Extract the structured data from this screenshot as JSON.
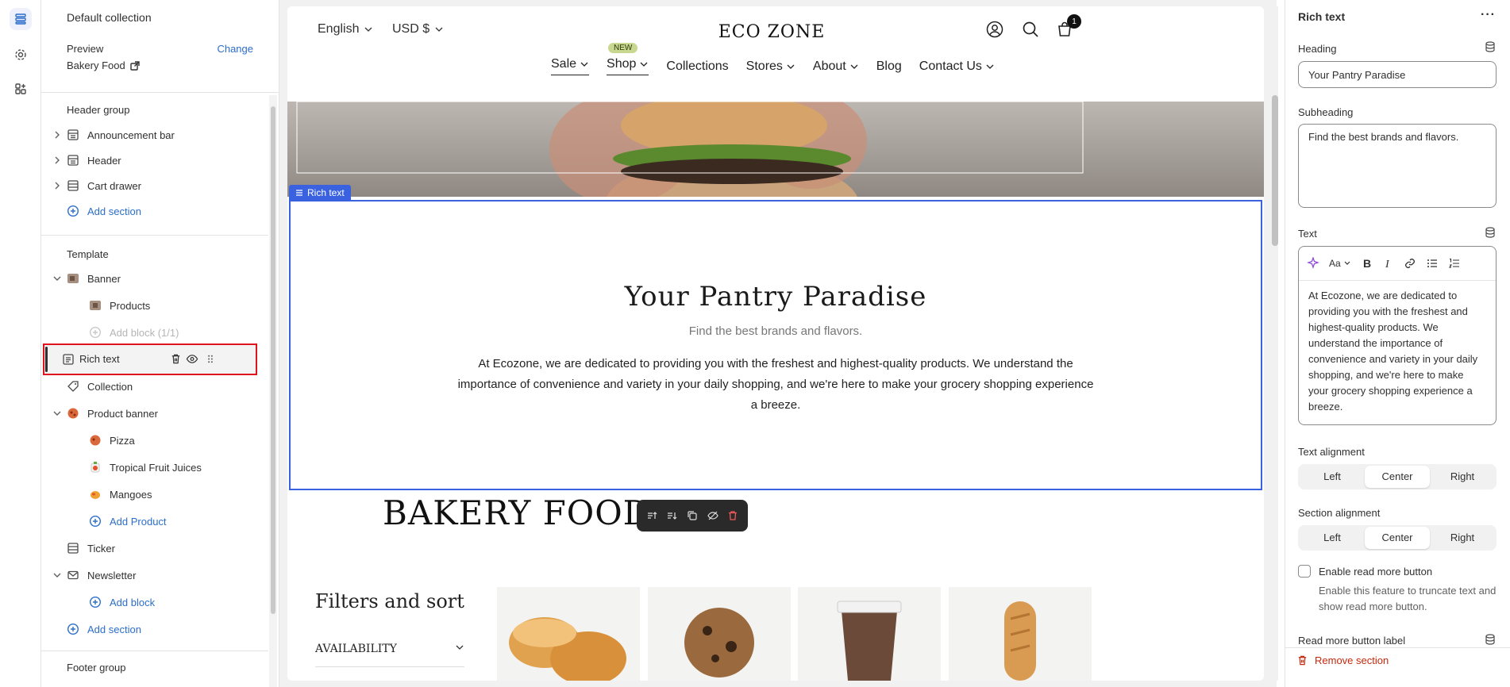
{
  "left_panel": {
    "collection_title": "Default collection",
    "preview_label": "Preview",
    "change_label": "Change",
    "store_name": "Bakery Food",
    "header_group": "Header group",
    "header_items": [
      "Announcement bar",
      "Header",
      "Cart drawer"
    ],
    "add_section": "Add section",
    "template_label": "Template",
    "banner": "Banner",
    "banner_child": "Products",
    "add_block_disabled": "Add block (1/1)",
    "rich_text": "Rich text",
    "collection": "Collection",
    "product_banner": "Product banner",
    "product_banner_children": [
      "Pizza",
      "Tropical Fruit Juices",
      "Mangoes"
    ],
    "add_product": "Add Product",
    "ticker": "Ticker",
    "newsletter": "Newsletter",
    "add_block": "Add block",
    "add_section_2": "Add section",
    "footer_group": "Footer group"
  },
  "store": {
    "language": "English",
    "currency": "USD $",
    "logo": "ECO ZONE",
    "cart_count": "1",
    "nav": [
      "Sale",
      "Shop",
      "Collections",
      "Stores",
      "About",
      "Blog",
      "Contact Us"
    ],
    "new_badge": "NEW",
    "rich_text_tag": "Rich text",
    "heading": "Your Pantry Paradise",
    "subheading": "Find the best brands and flavors.",
    "text": "At Ecozone, we are dedicated to providing you with the freshest and highest-quality products. We understand the importance of convenience and variety in your daily shopping, and we're here to make your grocery shopping experience a breeze.",
    "bakery_title": "BAKERY FOOD",
    "filters_title": "Filters and sort",
    "availability": "AVAILABILITY"
  },
  "right_panel": {
    "title": "Rich text",
    "heading_label": "Heading",
    "heading_value": "Your Pantry Paradise",
    "subheading_label": "Subheading",
    "subheading_value": "Find the best brands and flavors.",
    "text_label": "Text",
    "text_value": "At Ecozone, we are dedicated to providing you with the freshest and highest-quality products. We understand the importance of convenience and variety in your daily shopping, and we're here to make your grocery shopping experience a breeze.",
    "text_alignment_label": "Text alignment",
    "section_alignment_label": "Section alignment",
    "align_options": [
      "Left",
      "Center",
      "Right"
    ],
    "selected_text_alignment": "Center",
    "selected_section_alignment": "Center",
    "read_more_label": "Enable read more button",
    "read_more_help": "Enable this feature to truncate text and show read more button.",
    "read_more_btn_label": "Read more button label",
    "remove_section": "Remove section"
  },
  "colors": {
    "accent": "#2c6ecb",
    "selection": "#3a62e0",
    "highlight": "#e0141e",
    "danger": "#c5280c"
  }
}
